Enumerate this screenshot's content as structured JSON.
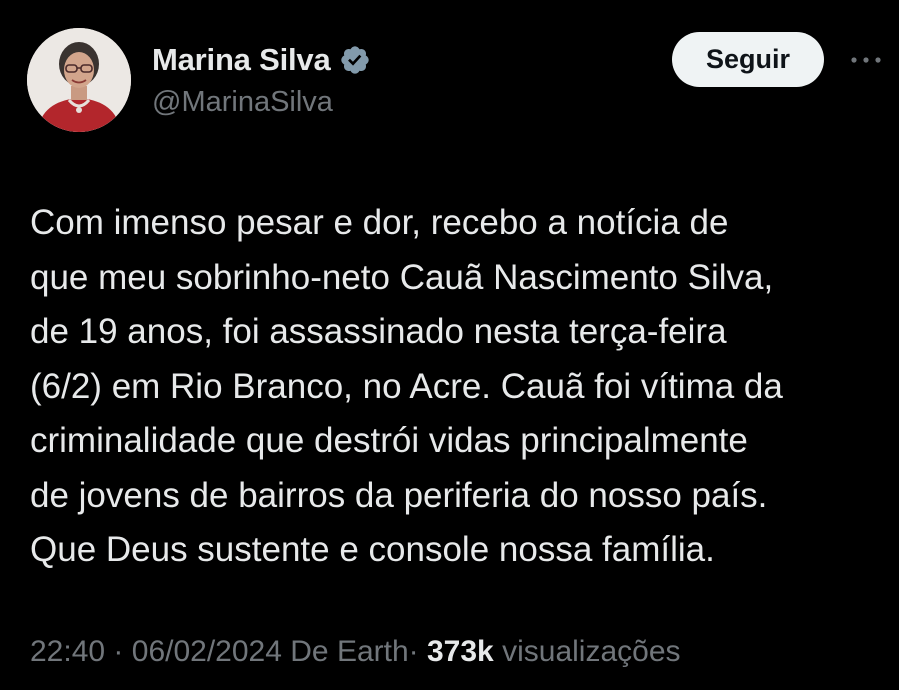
{
  "author": {
    "display_name": "Marina Silva",
    "handle": "@MarinaSilva",
    "verified_icon": "verified-badge-icon"
  },
  "actions": {
    "follow_label": "Seguir",
    "more_icon": "more-options-icon"
  },
  "post": {
    "text": "Com imenso pesar e dor, recebo a notícia de\nque meu sobrinho-neto Cauã Nascimento Silva,\nde 19 anos, foi assassinado nesta terça-feira\n(6/2) em Rio Branco, no Acre. Cauã foi vítima da\ncriminalidade que destrói vidas principalmente\nde jovens de bairros da periferia do nosso país.\nQue Deus sustente e console nossa família."
  },
  "meta": {
    "time": "22:40",
    "separator": "·",
    "date": "06/02/2024",
    "source": "De Earth",
    "views_count": "373k",
    "views_label": "visualizações"
  },
  "colors": {
    "background": "#000000",
    "primary_text": "#e7e9ea",
    "secondary_text": "#71767b",
    "follow_button_bg": "#eff3f4",
    "verified_badge": "#829aab"
  }
}
